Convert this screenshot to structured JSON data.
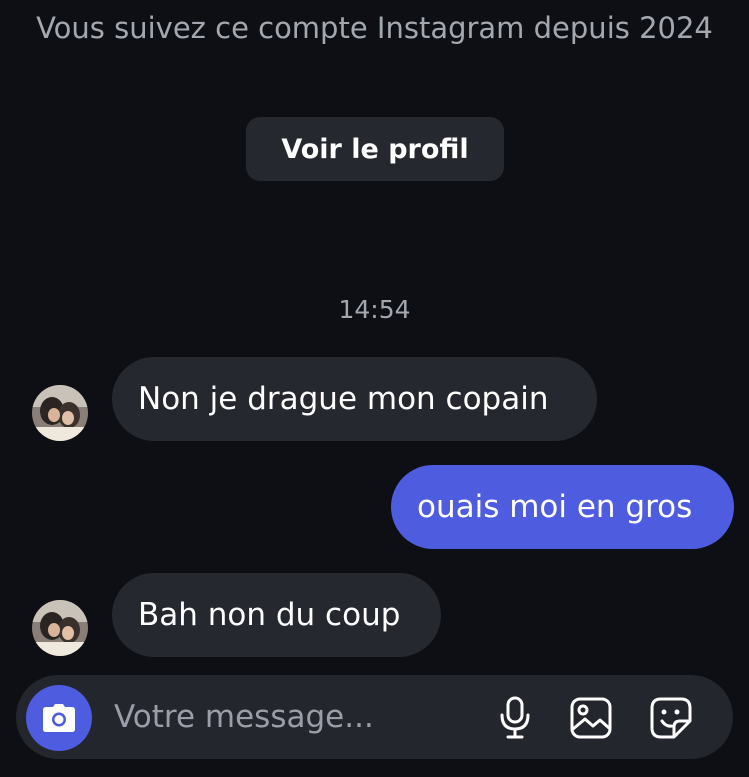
{
  "header": {
    "follow_info": "Vous suivez ce compte Instagram depuis 2024",
    "profile_button": "Voir le profil"
  },
  "conversation": {
    "timestamp": "14:54",
    "messages": [
      {
        "direction": "incoming",
        "text": "Non je drague mon copain",
        "has_avatar": true
      },
      {
        "direction": "outgoing",
        "text": "ouais moi en gros",
        "has_avatar": false
      },
      {
        "direction": "incoming",
        "text": "Bah non du coup",
        "has_avatar": true
      }
    ]
  },
  "composer": {
    "placeholder": "Votre message...",
    "icons": [
      "camera-icon",
      "microphone-icon",
      "gallery-icon",
      "sticker-icon"
    ]
  },
  "colors": {
    "background": "#0d0f14",
    "incoming_bubble": "#26282f",
    "outgoing_bubble": "#4e5ce0",
    "accent": "#4e5ce0",
    "muted_text": "#a3a7b0"
  }
}
